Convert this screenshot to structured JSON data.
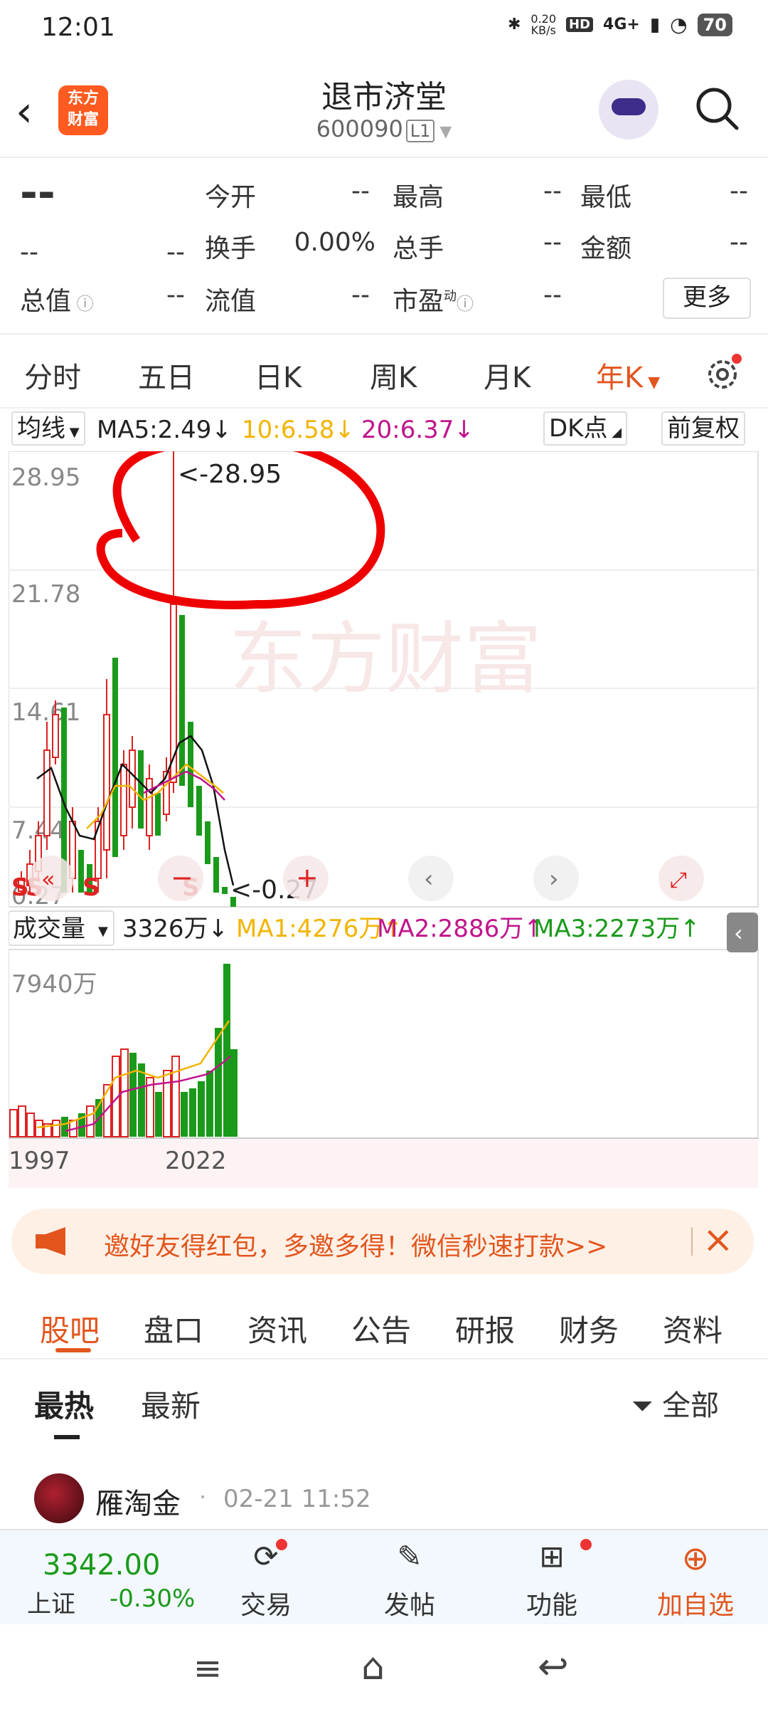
{
  "status": {
    "time": "12:01",
    "net_speed": "0.20\nKB/s",
    "network": "4G+",
    "battery": "70"
  },
  "header": {
    "logo_text": "东方\n财富",
    "title": "退市济堂",
    "code": "600090",
    "level": "L1"
  },
  "quote": {
    "price": "--",
    "change": "--",
    "change_pct": "--",
    "open_label": "今开",
    "open": "--",
    "high_label": "最高",
    "high": "--",
    "low_label": "最低",
    "low": "--",
    "turnover_label": "换手",
    "turnover": "0.00%",
    "volume_label": "总手",
    "volume": "--",
    "amount_label": "金额",
    "amount": "--",
    "mcap_label": "总值",
    "mcap": "--",
    "float_label": "流值",
    "float_cap": "--",
    "pe_label": "市盈",
    "pe_sup": "动",
    "pe": "--",
    "more_button": "更多"
  },
  "period_tabs": [
    "分时",
    "五日",
    "日K",
    "周K",
    "月K",
    "年K"
  ],
  "active_tab": "年K",
  "indicator": {
    "selector": "均线",
    "ma5": "MA5:2.49↓",
    "ma10": "10:6.58↓",
    "ma20": "20:6.37↓",
    "dk": "DK点",
    "adjust": "前复权"
  },
  "price_axis": [
    "28.95",
    "21.78",
    "14.61",
    "7.44",
    "0.27"
  ],
  "price_annotations": {
    "max": "<-28.95",
    "min": "<-0.27"
  },
  "markers": [
    "S",
    "S",
    "S",
    "S"
  ],
  "volume_indicator": {
    "selector": "成交量",
    "vol": "3326万↓",
    "ma1": "MA1:4276万↑",
    "ma2": "MA2:2886万↑",
    "ma3": "MA3:2273万↑"
  },
  "volume_axis": [
    "7940万"
  ],
  "x_axis": [
    "1997",
    "2022"
  ],
  "watermark": "东方财富",
  "promo": {
    "text": "邀好友得红包，多邀多得！微信秒速打款>>"
  },
  "sub_tabs": [
    "股吧",
    "盘口",
    "资讯",
    "公告",
    "研报",
    "财务",
    "资料"
  ],
  "active_sub_tab": "股吧",
  "sort_tabs": [
    "最热",
    "最新"
  ],
  "filter_label": "全部",
  "post": {
    "user": "雁淘金",
    "time": "02-21 11:52"
  },
  "footer": {
    "index_value": "3342.00",
    "index_name": "上证",
    "index_change": "-0.30%",
    "trade": "交易",
    "post": "发帖",
    "function": "功能",
    "add": "加自选"
  },
  "colors": {
    "accent": "#e2561e",
    "up": "#d22",
    "down": "#1a9a1a",
    "ma5": "#000",
    "ma10": "#f2b400",
    "ma20": "#c0148c"
  },
  "chart_data": {
    "type": "candlestick",
    "y_range": [
      0.27,
      28.95
    ],
    "max_high": 28.95,
    "min_low": 0.27,
    "volume_max": "7940万",
    "x_start": "1997",
    "x_end": "2022"
  }
}
